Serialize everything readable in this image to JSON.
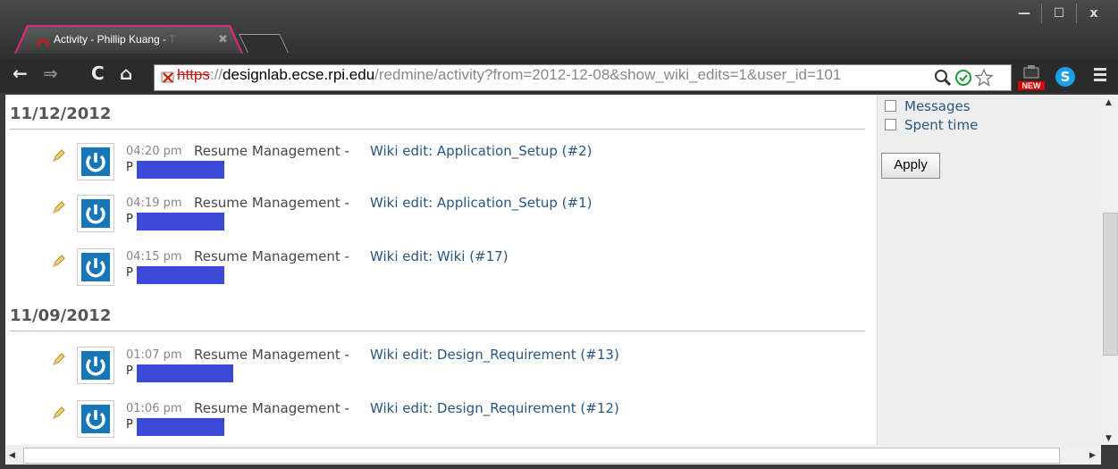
{
  "browser": {
    "tab_title": "Activity - Phillip Kuang - ",
    "tab_title_fade": "T",
    "tab_close": "✖",
    "window_buttons": {
      "minimize": "—",
      "maximize": "☐",
      "close": "x"
    },
    "nav": {
      "back": "←",
      "forward": "⇒",
      "reload": "C",
      "home": "⌂"
    },
    "url_protocol": "https",
    "url_sep": "://",
    "url_host": "designlab.ecse.rpi.edu",
    "url_rest": "/redmine/activity?from=2012-12-08&show_wiki_edits=1&user_id=101",
    "ext_new_label": "NEW",
    "skype_label": "S"
  },
  "activity": {
    "groups": [
      {
        "date": "11/12/2012",
        "entries": [
          {
            "time": "04:20 pm",
            "project": "Resume Management -",
            "link": "Wiki edit: Application_Setup (#2)",
            "author": "P"
          },
          {
            "time": "04:19 pm",
            "project": "Resume Management -",
            "link": "Wiki edit: Application_Setup (#1)",
            "author": "P"
          },
          {
            "time": "04:15 pm",
            "project": "Resume Management -",
            "link": "Wiki edit: Wiki (#17)",
            "author": "P"
          }
        ]
      },
      {
        "date": "11/09/2012",
        "entries": [
          {
            "time": "01:07 pm",
            "project": "Resume Management -",
            "link": "Wiki edit: Design_Requirement (#13)",
            "author": "P"
          },
          {
            "time": "01:06 pm",
            "project": "Resume Management -",
            "link": "Wiki edit: Design_Requirement (#12)",
            "author": "P"
          }
        ]
      }
    ]
  },
  "sidebar": {
    "filters": [
      "Messages",
      "Spent time"
    ],
    "apply_label": "Apply"
  },
  "colors": {
    "link": "#2a5685",
    "redaction": "#3b4ad6",
    "avatar": "#1776b8"
  }
}
